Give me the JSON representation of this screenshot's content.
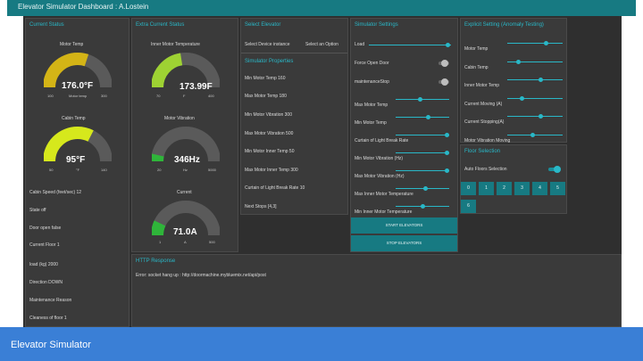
{
  "app_title": "Elevator Simulator Dashboard : A.Lostein",
  "footer_title": "Elevator Simulator",
  "panels": {
    "current_status": {
      "title": "Current Status",
      "motor_temp": {
        "label": "Motor Temp",
        "value": "176.0°F",
        "min": "100",
        "unit": "Motor temp",
        "max": "300",
        "level": 0.6
      },
      "cabin_temp": {
        "label": "Cabin Temp",
        "value": "95°F",
        "min": "50",
        "unit": "°F",
        "max": "140",
        "level": 0.65
      },
      "fields": [
        "Cabin Speed (feet/sec) 12",
        "State off",
        "Door open false",
        "Current Floor 1",
        "load (kg) 2000",
        "Direction DOWN",
        "Maintenance Reason",
        "Cleaness of floor 1"
      ]
    },
    "extra_status": {
      "title": "Extra Current Status",
      "inner_temp": {
        "label": "Inner Motor Temperature",
        "value": "173.99F",
        "min": "70",
        "unit": "F",
        "max": "400",
        "level": 0.45
      },
      "vibration": {
        "label": "Motor Vibration",
        "value": "346Hz",
        "min": "20",
        "unit": "Hz",
        "max": "5000",
        "level": 0.07
      },
      "current": {
        "label": "Current",
        "value": "71.0A",
        "min": "1",
        "unit": "A",
        "max": "500",
        "level": 0.14
      }
    },
    "select_elevator": {
      "title": "Select Elevator",
      "field_label": "Select Device instance",
      "option_label": "Select an Option"
    },
    "sim_properties": {
      "title": "Simulator Properties",
      "items": [
        "Min Motor Temp 160",
        "Max Motor Temp 180",
        "Min Motor Vibration 300",
        "Max Motor Vibration 500",
        "Min Motor Inner Temp 50",
        "Max Motor Inner Temp 300",
        "Curtain of Light Break Rate 10",
        "Next Stops [4,3]"
      ]
    },
    "sim_settings": {
      "title": "Simulator Settings",
      "load_label": "Load",
      "toggles": [
        {
          "label": "Force Open Door",
          "on": false
        },
        {
          "label": "maintenanceStop",
          "on": false
        }
      ],
      "sliders": [
        {
          "label": "Max Motor Temp",
          "level": 0.45
        },
        {
          "label": "Min Motor Temp",
          "level": 0.6
        },
        {
          "label": "Curtain of Light Break Rate",
          "level": 0.95
        },
        {
          "label": "Min Motor Vibration (Hz)",
          "level": 0.95
        },
        {
          "label": "Max Motor Vibration (Hz)",
          "level": 0.95
        },
        {
          "label": "Max Inner Motor Temperature",
          "level": 0.55
        },
        {
          "label": "Min Inner Motor Temperature",
          "level": 0.5
        }
      ],
      "start_label": "START ELEVATORS",
      "stop_label": "STOP ELEVATORS"
    },
    "explicit": {
      "title": "Explicit Setting (Anomaly Testing)",
      "sliders": [
        {
          "label": "Motor Temp",
          "level": 0.7
        },
        {
          "label": "Cabin Temp",
          "level": 0.2
        },
        {
          "label": "Inner Motor Temp",
          "level": 0.6
        },
        {
          "label": "Current Moving (A)",
          "level": 0.25
        },
        {
          "label": "Current Stopping(A)",
          "level": 0.6
        },
        {
          "label": "Motor Vibration Moving",
          "level": 0.45
        }
      ]
    },
    "floor_selection": {
      "title": "Floor Selection",
      "auto_label": "Auto Floors Selection",
      "auto_on": true,
      "floors": [
        "0",
        "1",
        "2",
        "3",
        "4",
        "5",
        "6"
      ]
    },
    "http": {
      "title": "HTTP Response",
      "message": "Error: socket hang up : http://doormachine.mybluemix.net/api/post"
    }
  }
}
